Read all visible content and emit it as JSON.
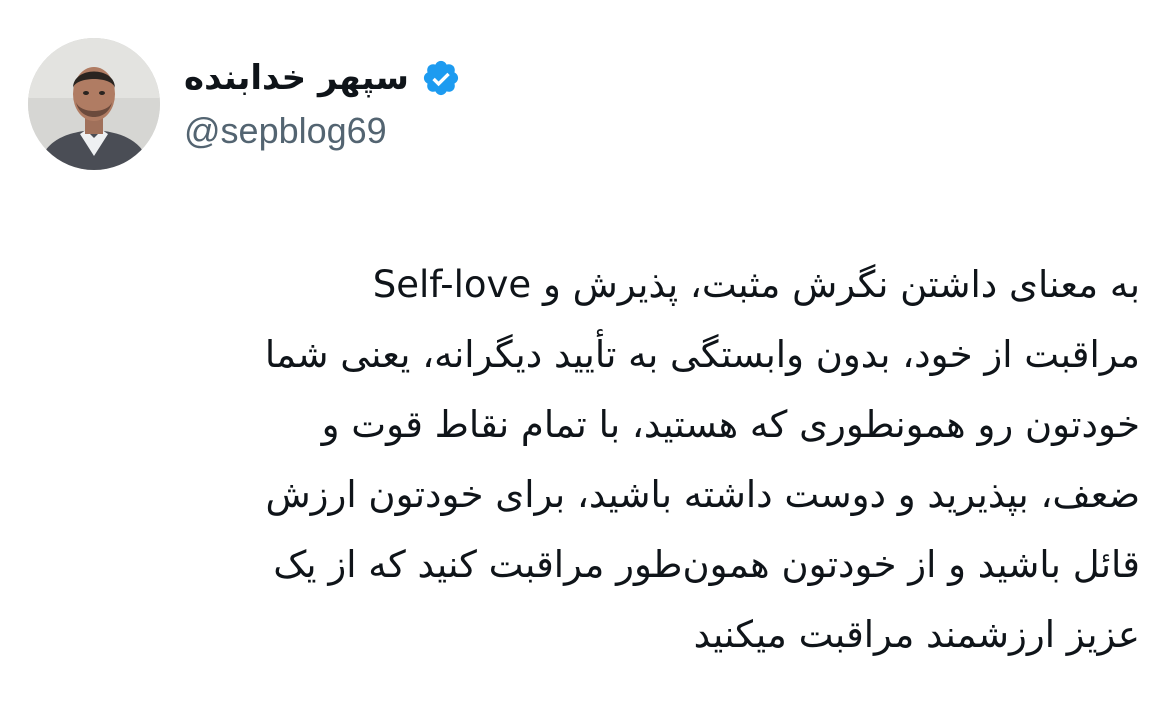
{
  "author": {
    "display_name": "سپهر خدابنده",
    "handle": "@sepblog69",
    "verified_icon": "verified-badge-icon",
    "verified_color": "#1d9bf0"
  },
  "tweet": {
    "lines": [
      "Self-love به معنای داشتن نگرش مثبت، پذیرش و",
      "مراقبت از خود، بدون وابستگی به تأیید دیگرانه، یعنی شما",
      "خودتون رو همونطوری که هستید، با تمام نقاط قوت و",
      "ضعف، بپذیرید و دوست داشته باشید، برای خودتون ارزش",
      "قائل باشید و از خودتون همون‌طور مراقبت کنید که از یک",
      "عزیز ارزشمند مراقبت میکنید"
    ]
  }
}
